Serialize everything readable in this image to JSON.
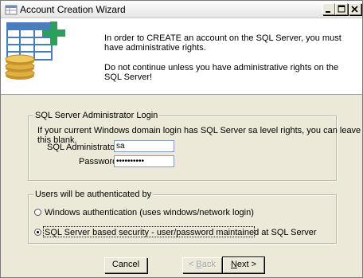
{
  "window": {
    "title": "Account Creation Wizard",
    "controls": {
      "minimize": "minimize",
      "maximize": "maximize",
      "close": "close"
    }
  },
  "header": {
    "line1": "In order to CREATE an account on the SQL Server, you must have administrative rights.",
    "line2": "Do not continue unless you have administrative rights on the SQL Server!",
    "icon": "table-add-coins-icon"
  },
  "login_group": {
    "legend": "SQL Server Administrator Login",
    "info": "If your current Windows domain login has SQL Server sa level rights, you can leave this blank.",
    "admin_id_label": "SQL Administrator ID:",
    "admin_id_value": "sa",
    "password_label": "Password:",
    "password_value": "••••••••••"
  },
  "auth_group": {
    "legend": "Users will be authenticated by",
    "options": [
      {
        "label": "Windows authentication (uses windows/network login)",
        "selected": false
      },
      {
        "label": "SQL Server based security - user/password maintained at SQL Server",
        "selected": true
      }
    ]
  },
  "buttons": {
    "cancel": "Cancel",
    "back_prefix": "< ",
    "back_mnemonic": "B",
    "back_suffix": "ack",
    "next_mnemonic": "N",
    "next_suffix": "ext >"
  },
  "colors": {
    "dialog_bg": "#ece9d8",
    "header_bg": "#ffffff",
    "table_blue": "#4a7ebb",
    "plus_green": "#2aa05a",
    "coin_gold": "#e0b040"
  }
}
